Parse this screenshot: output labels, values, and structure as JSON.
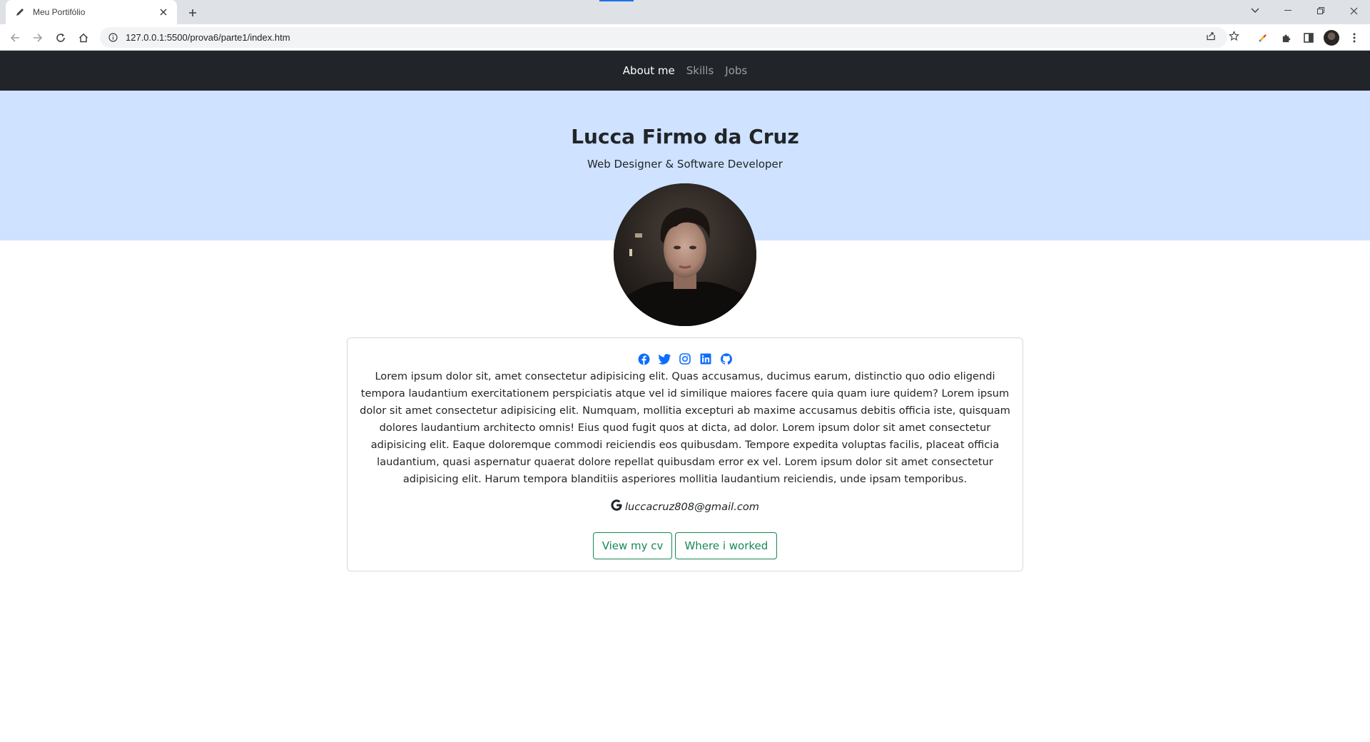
{
  "browser": {
    "tab_title": "Meu Portifólio",
    "url": "127.0.0.1:5500/prova6/parte1/index.htm",
    "icons": [
      "pencil-icon",
      "close-icon",
      "plus-icon",
      "chevron-down-icon",
      "minimize-icon",
      "restore-icon",
      "window-close-icon",
      "back-icon",
      "forward-icon",
      "reload-icon",
      "home-icon",
      "info-icon",
      "share-icon",
      "star-icon",
      "extension-colorful-icon",
      "puzzle-icon",
      "side-panel-icon",
      "profile-avatar",
      "kebab-menu-icon"
    ]
  },
  "nav": {
    "links": [
      {
        "label": "About me",
        "active": true
      },
      {
        "label": "Skills",
        "active": false
      },
      {
        "label": "Jobs",
        "active": false
      }
    ]
  },
  "hero": {
    "name": "Lucca Firmo da Cruz",
    "subtitle": "Web Designer & Software Developer",
    "accent": "#cfe2ff"
  },
  "card": {
    "social_icons": [
      "facebook-icon",
      "twitter-icon",
      "instagram-icon",
      "linkedin-icon",
      "github-icon"
    ],
    "social_color": "#0d6efd",
    "about": "Lorem ipsum dolor sit, amet consectetur adipisicing elit. Quas accusamus, ducimus earum, distinctio quo odio eligendi tempora laudantium exercitationem perspiciatis atque vel id similique maiores facere quia quam iure quidem? Lorem ipsum dolor sit amet consectetur adipisicing elit. Numquam, mollitia excepturi ab maxime accusamus debitis officia iste, quisquam dolores laudantium architecto omnis! Eius quod fugit quos at dicta, ad dolor. Lorem ipsum dolor sit amet consectetur adipisicing elit. Eaque doloremque commodi reiciendis eos quibusdam. Tempore expedita voluptas facilis, placeat officia laudantium, quasi aspernatur quaerat dolore repellat quibusdam error ex vel. Lorem ipsum dolor sit amet consectetur adipisicing elit. Harum tempora blanditiis asperiores mollitia laudantium reiciendis, unde ipsam temporibus.",
    "email": "luccacruz808@gmail.com",
    "email_icon": "google-icon",
    "buttons": {
      "cv": "View my cv",
      "jobs": "Where i worked"
    },
    "button_color": "#198754"
  }
}
